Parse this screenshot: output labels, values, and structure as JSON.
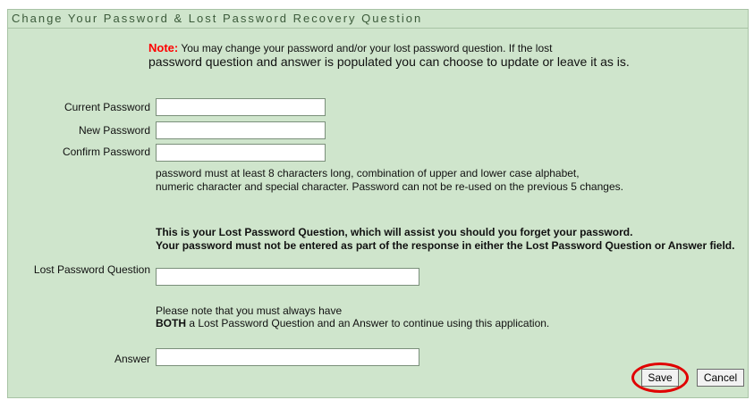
{
  "title": "Change Your Password & Lost Password Recovery Question",
  "note": {
    "label": "Note:",
    "line1": " You may change your password and/or your lost password question. If the lost",
    "line2": "password question and answer is populated you can choose to update or leave it as is."
  },
  "fields": {
    "current_password_label": "Current Password",
    "new_password_label": "New Password",
    "confirm_password_label": "Confirm Password",
    "lost_question_label": "Lost Password Question",
    "answer_label": "Answer"
  },
  "password_hint": {
    "line1": "password must at least 8 characters long, combination of upper and lower case alphabet,",
    "line2": "numeric character and special character. Password can not be re-used on the previous 5 changes."
  },
  "question_info": {
    "line1": "This is your Lost Password Question, which will assist you should you forget your password.",
    "line2": "Your password must not be entered as part of the response in either the Lost Password Question or Answer field."
  },
  "must_have": {
    "line1": "Please note that you must always have",
    "line2_bold": "BOTH",
    "line2_rest": " a Lost Password Question and an Answer to continue using this application."
  },
  "buttons": {
    "save": "Save",
    "cancel": "Cancel"
  },
  "colors": {
    "panel_bg": "#cfe5cc",
    "title_text": "#3b5a3a",
    "note_label": "#ff0000",
    "highlight_circle": "#e00000"
  }
}
